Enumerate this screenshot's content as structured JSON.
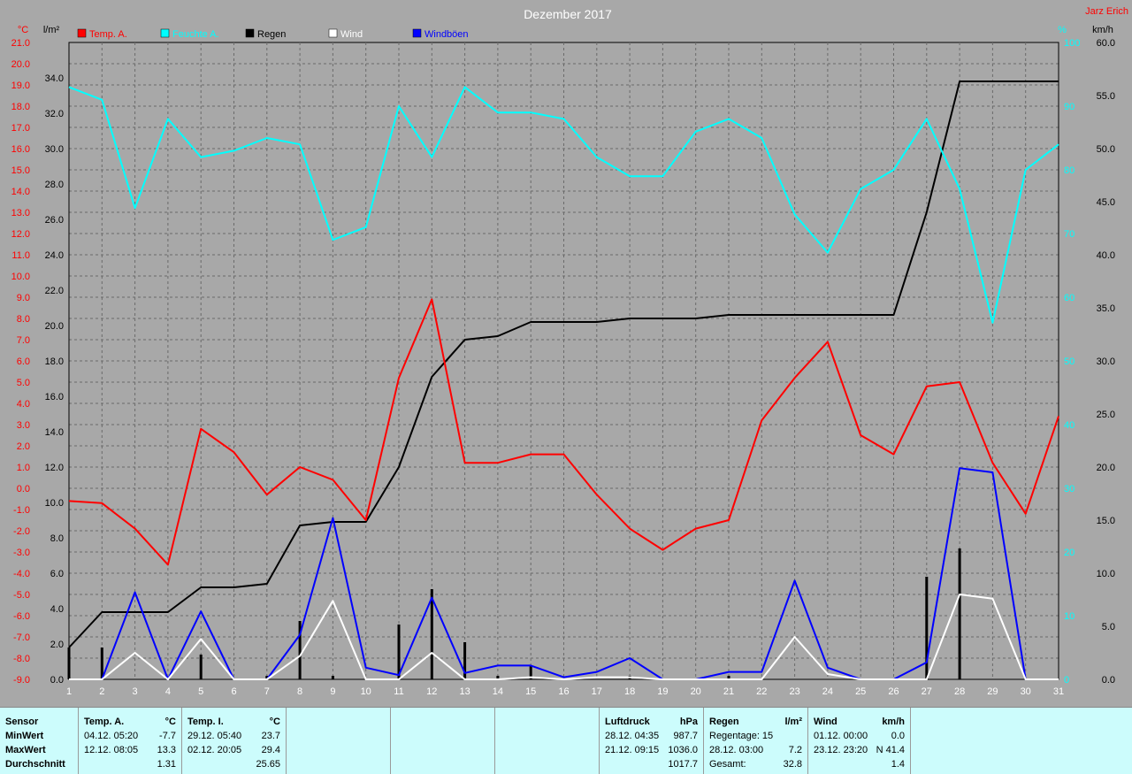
{
  "title": "Dezember 2017",
  "author": "Jarz Erich",
  "units": {
    "celsius": "°C",
    "rain": "l/m²",
    "percent": "%",
    "kmh": "km/h"
  },
  "legend": [
    {
      "label": "Temp. A.",
      "color": "#ff0000"
    },
    {
      "label": "Feuchte A.",
      "color": "#00ffff"
    },
    {
      "label": "Regen",
      "color": "#000000"
    },
    {
      "label": "Wind",
      "color": "#ffffff"
    },
    {
      "label": "Windböen",
      "color": "#0000ff"
    }
  ],
  "chart_data": {
    "type": "line",
    "title": "Dezember 2017",
    "x": [
      1,
      2,
      3,
      4,
      5,
      6,
      7,
      8,
      9,
      10,
      11,
      12,
      13,
      14,
      15,
      16,
      17,
      18,
      19,
      20,
      21,
      22,
      23,
      24,
      25,
      26,
      27,
      28,
      29,
      30,
      31
    ],
    "axes": {
      "temp": {
        "range": [
          -9,
          21
        ],
        "ticks": [
          "21.0",
          "20.0",
          "19.0",
          "18.0",
          "17.0",
          "16.0",
          "15.0",
          "14.0",
          "13.0",
          "12.0",
          "11.0",
          "10.0",
          "9.0",
          "8.0",
          "7.0",
          "6.0",
          "5.0",
          "4.0",
          "3.0",
          "2.0",
          "1.0",
          "0.0",
          "-1.0",
          "-2.0",
          "-3.0",
          "-4.0",
          "-5.0",
          "-6.0",
          "-7.0",
          "-8.0",
          "-9.0"
        ]
      },
      "rain": {
        "range": [
          0,
          36
        ],
        "ticks": [
          "34.0",
          "32.0",
          "30.0",
          "28.0",
          "26.0",
          "24.0",
          "22.0",
          "20.0",
          "18.0",
          "16.0",
          "14.0",
          "12.0",
          "10.0",
          "8.0",
          "6.0",
          "4.0",
          "2.0",
          "0.0"
        ]
      },
      "humidity": {
        "range": [
          0,
          100
        ],
        "ticks": [
          "100",
          "90",
          "80",
          "70",
          "60",
          "50",
          "40",
          "30",
          "20",
          "10",
          "0"
        ]
      },
      "wind": {
        "range": [
          0,
          60
        ],
        "ticks": [
          "60.0",
          "55.0",
          "50.0",
          "45.0",
          "40.0",
          "35.0",
          "30.0",
          "25.0",
          "20.0",
          "15.0",
          "10.0",
          "5.0",
          "0.0"
        ]
      }
    },
    "series": [
      {
        "name": "Temp. A.",
        "axis": "temp",
        "color": "#ff0000",
        "values": [
          -0.6,
          -0.7,
          -1.9,
          -3.6,
          2.8,
          1.7,
          -0.3,
          1.0,
          0.4,
          -1.5,
          5.2,
          8.9,
          1.2,
          1.2,
          1.6,
          1.6,
          -0.3,
          -1.9,
          -2.9,
          -1.9,
          -1.5,
          3.2,
          5.2,
          6.9,
          2.5,
          1.6,
          4.8,
          5.0,
          1.2,
          -1.2,
          3.4
        ]
      },
      {
        "name": "Feuchte A.",
        "axis": "humidity",
        "color": "#00ffff",
        "values": [
          93,
          91,
          74,
          88,
          82,
          83,
          85,
          84,
          69,
          71,
          90,
          82,
          93,
          89,
          89,
          88,
          82,
          79,
          79,
          86,
          88,
          85,
          73,
          67,
          77,
          80,
          88,
          77,
          56,
          80,
          84
        ]
      },
      {
        "name": "Regen",
        "axis": "rain",
        "color": "#000000",
        "values": [
          1.8,
          3.8,
          3.8,
          3.8,
          5.2,
          5.2,
          5.4,
          8.7,
          8.9,
          8.9,
          12.0,
          17.1,
          19.2,
          19.4,
          20.2,
          20.2,
          20.2,
          20.4,
          20.4,
          20.4,
          20.6,
          20.6,
          20.6,
          20.6,
          20.6,
          20.6,
          26.4,
          33.8,
          33.8,
          33.8,
          33.8
        ]
      },
      {
        "name": "Regen (täglich)",
        "axis": "rain",
        "color": "#000000",
        "values": [
          1.8,
          1.8,
          0,
          0,
          1.4,
          0,
          0.2,
          3.3,
          0.2,
          0,
          3.1,
          5.1,
          2.1,
          0.2,
          0.8,
          0,
          0,
          0.2,
          0,
          0,
          0.2,
          0,
          0,
          0,
          0,
          0,
          5.8,
          7.4,
          0,
          0,
          0
        ]
      },
      {
        "name": "Wind",
        "axis": "wind",
        "color": "#ffffff",
        "values": [
          0,
          0,
          2.5,
          0,
          3.8,
          0,
          0,
          2.2,
          7.4,
          0,
          0,
          2.5,
          0,
          0,
          0.2,
          0,
          0.2,
          0.2,
          0,
          0,
          0,
          0,
          4.0,
          0.5,
          0,
          0,
          0,
          8.0,
          7.6,
          0,
          0
        ]
      },
      {
        "name": "Windböen",
        "axis": "wind",
        "color": "#0000ff",
        "values": [
          0,
          0,
          8.2,
          0,
          6.4,
          0,
          0,
          4.2,
          15.2,
          1.1,
          0.4,
          7.7,
          0.6,
          1.3,
          1.3,
          0.2,
          0.7,
          2.0,
          0,
          0,
          0.7,
          0.7,
          9.3,
          1.1,
          0,
          0,
          1.6,
          19.9,
          19.5,
          0,
          0
        ]
      }
    ]
  },
  "stats": {
    "sensor": {
      "header": "Sensor",
      "rows": [
        "MinWert",
        "MaxWert",
        "Durchschnitt"
      ]
    },
    "temp_a": {
      "header": "Temp. A.",
      "unit": "°C",
      "min": {
        "when": "04.12.  05:20",
        "value": "-7.7"
      },
      "max": {
        "when": "12.12.  08:05",
        "value": "13.3"
      },
      "avg": "1.31"
    },
    "temp_i": {
      "header": "Temp. I.",
      "unit": "°C",
      "min": {
        "when": "29.12.  05:40",
        "value": "23.7"
      },
      "max": {
        "when": "02.12.  20:05",
        "value": "29.4"
      },
      "avg": "25.65"
    },
    "pressure": {
      "header": "Luftdruck",
      "unit": "hPa",
      "min": {
        "when": "28.12.  04:35",
        "value": "987.7"
      },
      "max": {
        "when": "21.12.  09:15",
        "value": "1036.0"
      },
      "avg": "1017.7"
    },
    "rain": {
      "header": "Regen",
      "unit": "l/m²",
      "days": "Regentage: 15",
      "max": {
        "when": "28.12.  03:00",
        "value": "7.2"
      },
      "total_label": "Gesamt:",
      "total": "32.8"
    },
    "wind": {
      "header": "Wind",
      "unit": "km/h",
      "min": {
        "when": "01.12.  00:00",
        "value": "0.0"
      },
      "max": {
        "when": "23.12.  23:20",
        "value": "N 41.4"
      },
      "avg": "1.4"
    }
  }
}
